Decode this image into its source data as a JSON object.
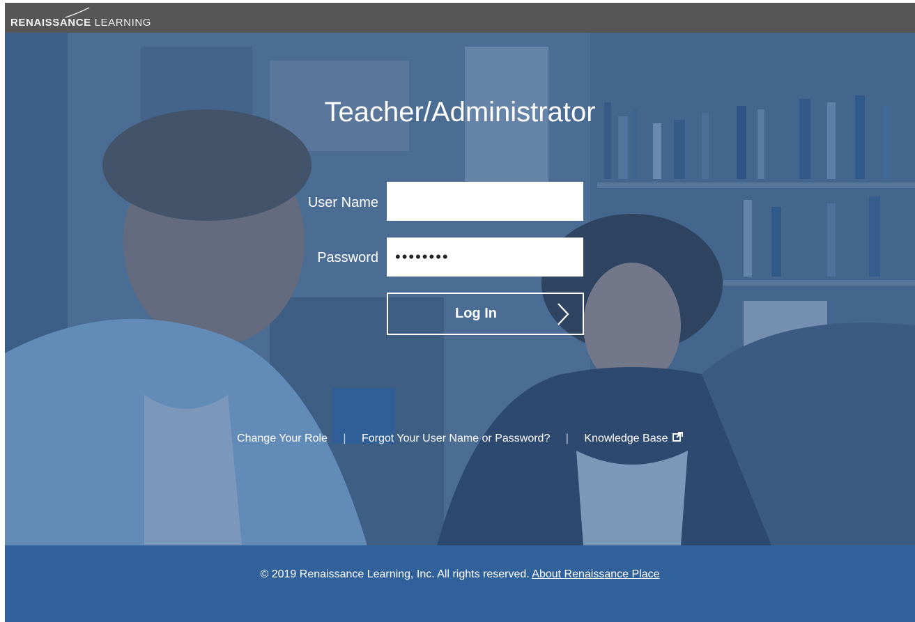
{
  "header": {
    "logo_bold": "RENAISSANCE",
    "logo_light": "LEARNING"
  },
  "login": {
    "title": "Teacher/Administrator",
    "username_label": "User Name",
    "username_value": "",
    "password_label": "Password",
    "password_value": "12345678",
    "login_label": "Log In"
  },
  "links": {
    "change_role": "Change Your Role",
    "separator": "|",
    "forgot": "Forgot Your User Name or Password?",
    "knowledge_base": "Knowledge Base"
  },
  "footer": {
    "copyright": "© 2019 Renaissance Learning, Inc. All rights reserved.",
    "about_link": "About Renaissance Place"
  },
  "colors": {
    "topbar": "#565656",
    "hero_overlay": "#315c91",
    "footer": "#31619a"
  },
  "icons": {
    "login_arrow": "chevron-right-icon",
    "external_link": "external-link-icon"
  }
}
